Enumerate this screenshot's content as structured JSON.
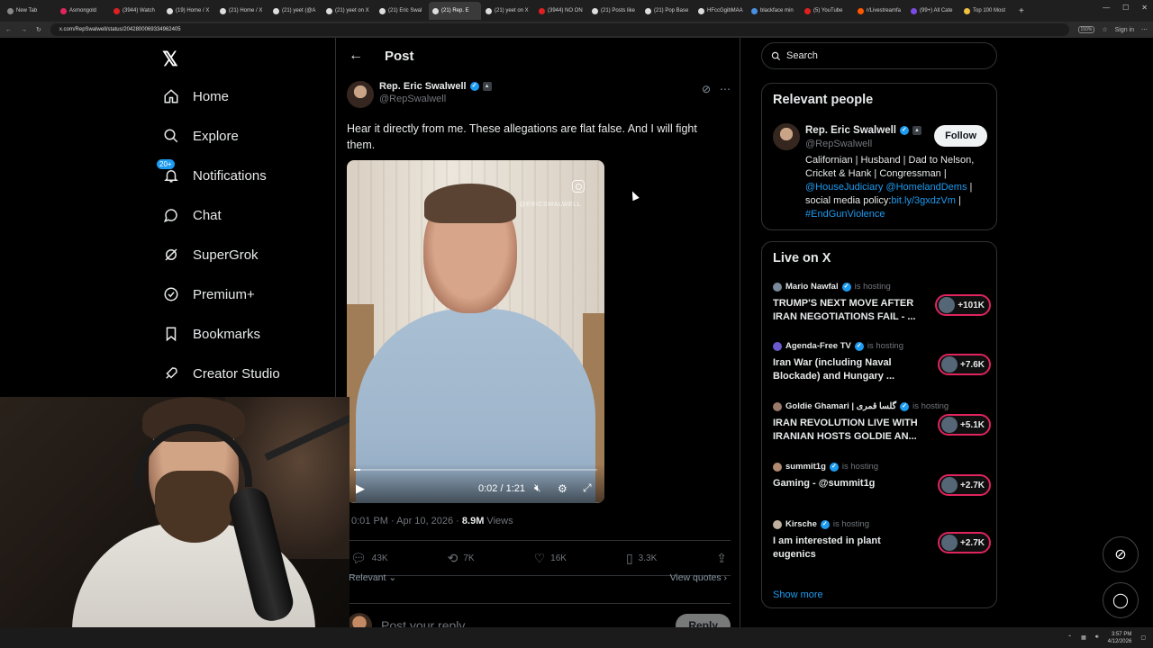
{
  "browser": {
    "tabs": [
      {
        "label": "New Tab",
        "color": "#888888"
      },
      {
        "label": "Asmongold",
        "color": "#e0245e"
      },
      {
        "label": "(3944) Watch",
        "color": "#e02020"
      },
      {
        "label": "(19) Home / X",
        "color": "#dddddd"
      },
      {
        "label": "(21) Home / X",
        "color": "#dddddd"
      },
      {
        "label": "(21) yeet (@A",
        "color": "#dddddd"
      },
      {
        "label": "(21) yeet on X",
        "color": "#dddddd"
      },
      {
        "label": "(21) Eric Swal",
        "color": "#dddddd"
      },
      {
        "label": "(21) Rep. E",
        "color": "#dddddd",
        "active": true
      },
      {
        "label": "(21) yeet on X",
        "color": "#dddddd"
      },
      {
        "label": "(3944) NO ON",
        "color": "#e02020"
      },
      {
        "label": "(21) Posts like",
        "color": "#dddddd"
      },
      {
        "label": "(21) Pop Base",
        "color": "#dddddd"
      },
      {
        "label": "HFccGgibMAA",
        "color": "#dddddd"
      },
      {
        "label": "blackface min",
        "color": "#4a90e2"
      },
      {
        "label": "(5) YouTube",
        "color": "#e02020"
      },
      {
        "label": "r/Livestreamfa",
        "color": "#ff5700"
      },
      {
        "label": "(99+) All Cate",
        "color": "#7b4ae2"
      },
      {
        "label": "Top 100 Most",
        "color": "#f0c040"
      }
    ],
    "url": "x.com/RepSwalwell/status/2042800069334962405",
    "zoom": "150%",
    "signin": "Sign in"
  },
  "nav": {
    "logo": "𝕏",
    "items": [
      {
        "key": "home",
        "label": "Home"
      },
      {
        "key": "explore",
        "label": "Explore"
      },
      {
        "key": "notifications",
        "label": "Notifications",
        "badge": "20+"
      },
      {
        "key": "chat",
        "label": "Chat"
      },
      {
        "key": "supergrok",
        "label": "SuperGrok"
      },
      {
        "key": "premium",
        "label": "Premium+"
      },
      {
        "key": "bookmarks",
        "label": "Bookmarks"
      },
      {
        "key": "creator-studio",
        "label": "Creator Studio"
      }
    ]
  },
  "post": {
    "header_title": "Post",
    "author_name": "Rep. Eric Swalwell",
    "author_handle": "@RepSwalwell",
    "text": "Hear it directly from me.  These allegations are flat false.  And I will fight them.",
    "video": {
      "watermark": "@ERICSWALWELL",
      "time": "0:02 / 1:21",
      "progress": 0.025
    },
    "timestamp": "0:01 PM · Apr 10, 2026 · ",
    "views_count": "8.9M",
    "views_label": " Views",
    "stats": {
      "replies": "43K",
      "reposts": "7K",
      "likes": "16K",
      "bookmarks": "3.3K"
    },
    "sort_label": "Relevant",
    "view_quotes": "View quotes",
    "reply_placeholder": "Post your reply",
    "reply_button": "Reply"
  },
  "sidebar": {
    "search_placeholder": "Search",
    "relevant_people": {
      "title": "Relevant people",
      "name": "Rep. Eric Swalwell",
      "handle": "@RepSwalwell",
      "follow": "Follow",
      "bio_text": "Californian | Husband | Dad to Nelson, Cricket & Hank | Congressman | ",
      "bio_link1": "@HouseJudiciary",
      "bio_link2": "@HomelandDems",
      "bio_mid": " | social media policy:",
      "bio_link3": "bit.ly/3gxdzVm",
      "bio_end": " | ",
      "bio_link4": "#EndGunViolence"
    },
    "live": {
      "title": "Live on X",
      "hosting": "is hosting",
      "items": [
        {
          "host": "Mario Nawfal",
          "title": "TRUMP'S NEXT MOVE AFTER IRAN NEGOTIATIONS FAIL - ...",
          "count": "+101K"
        },
        {
          "host": "Agenda-Free TV",
          "title": "Iran War (including Naval Blockade) and Hungary ...",
          "count": "+7.6K"
        },
        {
          "host": "Goldie Ghamari | گلسا قمری",
          "title": "IRAN REVOLUTION LIVE WITH IRANIAN HOSTS GOLDIE AN...",
          "count": "+5.1K"
        },
        {
          "host": "summit1g",
          "title": "Gaming - @summit1g",
          "count": "+2.7K"
        },
        {
          "host": "Kirsche",
          "title": "I am interested in plant eugenics",
          "count": "+2.7K"
        }
      ],
      "show_more": "Show more"
    }
  },
  "taskbar": {
    "time": "3:57 PM",
    "date": "4/12/2026"
  },
  "colors": {
    "accent": "#1d9bf0",
    "live_ring": "#e0245e",
    "background": "#000000"
  }
}
